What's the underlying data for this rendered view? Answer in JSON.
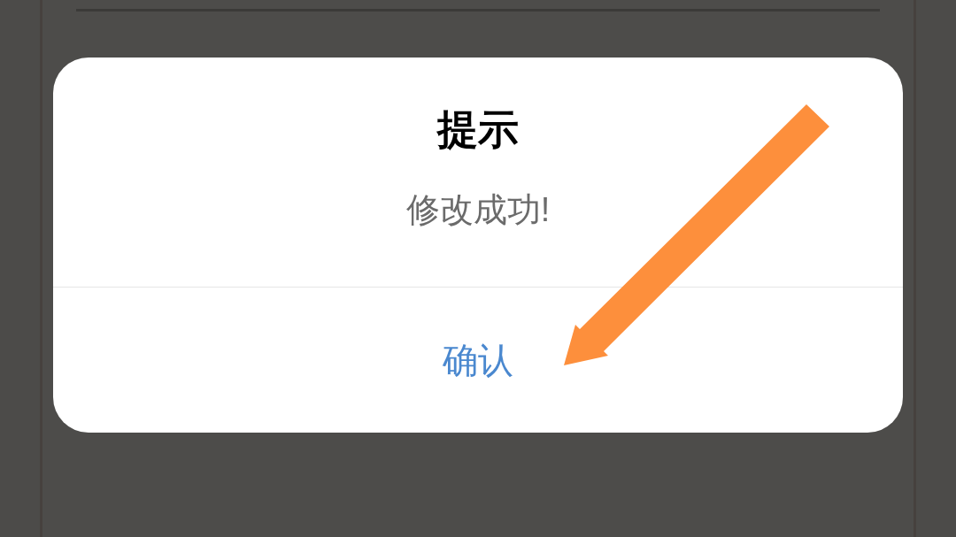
{
  "dialog": {
    "title": "提示",
    "message": "修改成功!",
    "buttons": [
      {
        "label": "确认"
      }
    ]
  }
}
